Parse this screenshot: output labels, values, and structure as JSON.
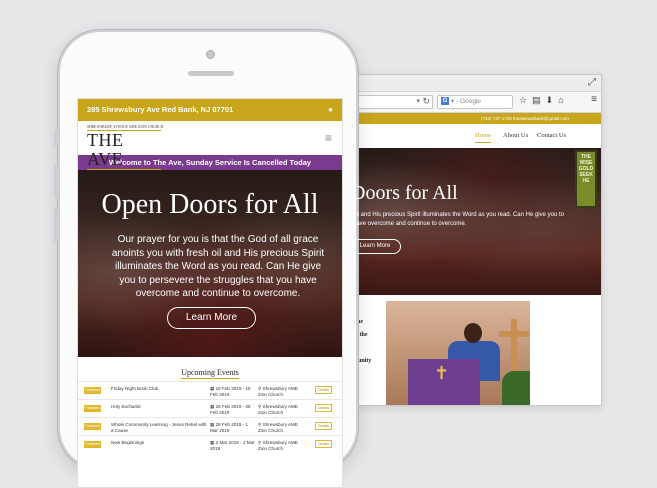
{
  "desktop": {
    "search_placeholder": "Google",
    "search_engine_glyph": "G",
    "url_dropdown_icon": "chevron-down-icon",
    "topbar_text": "(732) 747-1736   theavenuebank@gmail.com",
    "nav": [
      {
        "label": "Home",
        "active": true
      },
      {
        "label": "About Us",
        "active": false
      },
      {
        "label": "Contact Us",
        "active": false
      }
    ],
    "hero_title": "Doors for All",
    "hero_text_line1": "pll and His precious Spirit illuminates the Word as you read. Can He give you to",
    "hero_text_line2": "have overcome and continue to overcome.",
    "hero_button": "Learn More",
    "stained_glass_text": "THE WISE GOLD SEEK HE",
    "left_fragments": [
      "R",
      "The",
      "of the",
      "d",
      "munity"
    ]
  },
  "phone": {
    "address": "285 Shrewsbury Ave Red Bank, NJ 07701",
    "logo_small": "SHREWSBURY AVENUE AME ZION CHURCH",
    "logo_big": "THE AVE",
    "banner": "Welcome to The Ave, Sunday Service Is Cancelled Today",
    "hero_title": "Open Doors for All",
    "hero_text": "Our prayer for you is that the God of all grace anoints you with fresh oil and His precious Spirit illuminates the Word as you read. Can He give you to persevere the struggles that you have overcome and continue to overcome.",
    "hero_button": "Learn More",
    "events_title": "Upcoming Events",
    "events": [
      {
        "badge": "Featured",
        "name": "Friday Night Book Club",
        "date": "15 Feb 2019 - 15 Feb 2019",
        "location": "Shrewsbury AME Zion Church",
        "button": "Details"
      },
      {
        "badge": "Featured",
        "name": "Holy Eucharist",
        "date": "26 Feb 2019 - 26 Feb 2019",
        "location": "Shrewsbury AME Zion Church",
        "button": "Details"
      },
      {
        "badge": "Featured",
        "name": "Whole Community Learning - Jesus Rebel with a Cause",
        "date": "26 Feb 2019 - 1 Mar 2019",
        "location": "Shrewsbury AME Zion Church",
        "button": "Details"
      },
      {
        "badge": "Featured",
        "name": "New Beginnings",
        "date": "2 Mar 2019 - 2 Mar 2019",
        "location": "Shrewsbury AME Zion Church",
        "button": "Details"
      }
    ]
  },
  "colors": {
    "gold": "#c9a51c",
    "purple": "#7a3a8e"
  }
}
